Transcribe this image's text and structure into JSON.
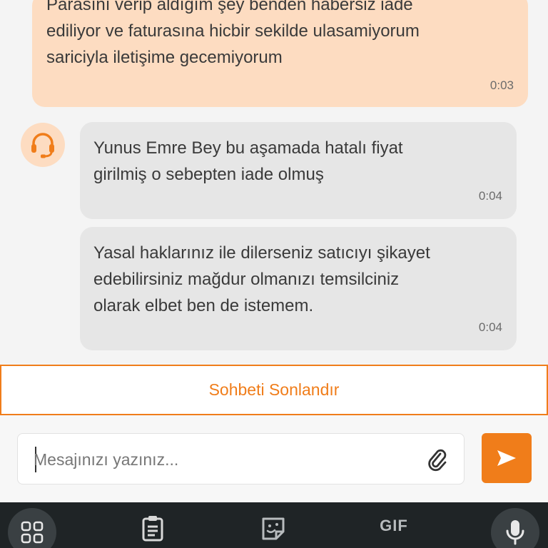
{
  "messages": [
    {
      "sender": "user",
      "text": "Parasını verip aldığım şey benden habersiz iade\nediliyor ve faturasına hicbir sekilde ulasamiyorum\nsariciyla iletişime gecemiyorum",
      "time": "0:03"
    },
    {
      "sender": "agent",
      "text": "Yunus Emre Bey bu aşamada hatalı fiyat\ngirilmiş o sebepten iade olmuş",
      "time": "0:04"
    },
    {
      "sender": "agent",
      "text": "Yasal haklarınız ile dilerseniz satıcıyı şikayet\nedebilirsiniz mağdur olmanızı temsilciniz\nolarak elbet ben de istemem.",
      "time": "0:04"
    }
  ],
  "end_chat_label": "Sohbeti Sonlandır",
  "composer": {
    "placeholder": "Mesajınızı yazınız...",
    "value": "",
    "attach_icon": "paperclip-icon",
    "send_icon": "send-icon"
  },
  "keyboard_toolbar": {
    "gif_label": "GIF",
    "icons": [
      "apps-grid-icon",
      "clipboard-icon",
      "sticker-icon",
      "gif-icon",
      "microphone-icon"
    ]
  },
  "colors": {
    "accent": "#f07d1a",
    "user_bubble": "#fddcc1",
    "agent_bubble": "#e6e6e6",
    "keyboard_bar": "#1f2426"
  }
}
